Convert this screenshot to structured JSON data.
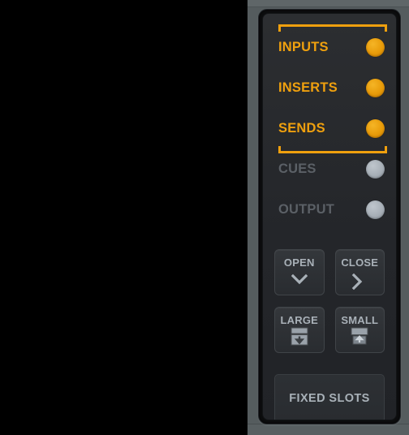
{
  "panel": {
    "name": "mixer-view-options-panel",
    "accent_color": "#efa00e",
    "inactive_color": "#5b6066",
    "led_off_color": "#a6aeb6",
    "panel_bg_color": "#26282b",
    "bezel_color": "#555c5e",
    "canvas_color": "#000000"
  },
  "view_rows": [
    {
      "label": "INPUTS",
      "state": "on",
      "led": "led-on"
    },
    {
      "label": "INSERTS",
      "state": "on",
      "led": "led-on"
    },
    {
      "label": "SENDS",
      "state": "on",
      "led": "led-on"
    },
    {
      "label": "CUES",
      "state": "off",
      "led": "led-off"
    },
    {
      "label": "OUTPUT",
      "state": "off",
      "led": "led-off"
    }
  ],
  "group_bracket": {
    "visible": true,
    "spans_rows": [
      "INPUTS",
      "SENDS"
    ]
  },
  "buttons": [
    {
      "label": "OPEN",
      "icon": "chevron-down-icon"
    },
    {
      "label": "CLOSE",
      "icon": "chevron-right-icon"
    },
    {
      "label": "LARGE",
      "icon": "expand-down-icon"
    },
    {
      "label": "SMALL",
      "icon": "collapse-up-icon"
    }
  ],
  "fixed_slots": {
    "label": "FIXED SLOTS"
  }
}
